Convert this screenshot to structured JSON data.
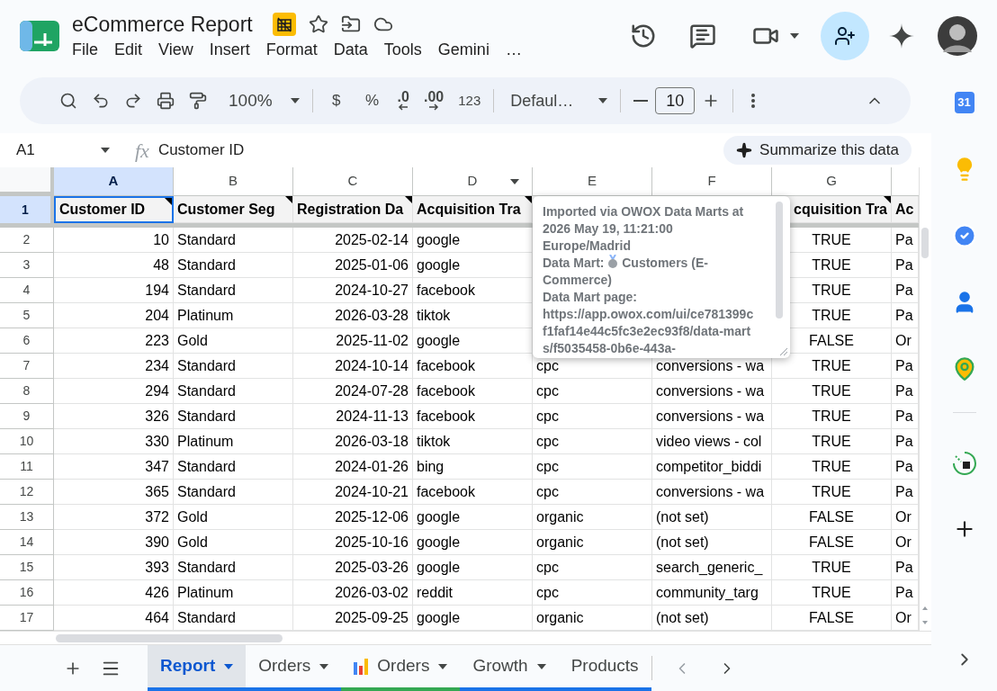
{
  "app": {
    "title": "eCommerce Report",
    "menu": [
      "File",
      "Edit",
      "View",
      "Insert",
      "Format",
      "Data",
      "Tools",
      "Gemini",
      "…"
    ]
  },
  "toolbar": {
    "zoom": "100%",
    "currency": "$",
    "percent": "%",
    "decrease_decimal": ".0",
    "increase_decimal": ".00",
    "number_format": "123",
    "font": "Defaul…",
    "font_size": "10"
  },
  "formula_bar": {
    "cell_ref": "A1",
    "fx": "fx",
    "value": "Customer ID",
    "summarize": "Summarize this data"
  },
  "sheet": {
    "columns": [
      {
        "letter": "A",
        "selected": true,
        "filter": false
      },
      {
        "letter": "B",
        "selected": false,
        "filter": false
      },
      {
        "letter": "C",
        "selected": false,
        "filter": false
      },
      {
        "letter": "D",
        "selected": false,
        "filter": true
      },
      {
        "letter": "E",
        "selected": false,
        "filter": false
      },
      {
        "letter": "F",
        "selected": false,
        "filter": false
      },
      {
        "letter": "G",
        "selected": false,
        "filter": false
      }
    ],
    "header_row": {
      "number": "1",
      "selected": true,
      "cells": [
        {
          "text": "Customer ID",
          "note": true,
          "selected": true
        },
        {
          "text": "Customer Seg",
          "note": true,
          "selected": false
        },
        {
          "text": "Registration Da",
          "note": true,
          "selected": false
        },
        {
          "text": "Acquisition Tra",
          "note": true,
          "selected": false
        },
        null,
        null,
        {
          "text": "cquisition Tra",
          "note": true,
          "selected": false
        },
        {
          "text": "Ac",
          "note": false,
          "selected": false
        }
      ]
    },
    "rows": [
      {
        "number": "2",
        "cells": [
          "10",
          "Standard",
          "2025-02-14",
          "google",
          null,
          null,
          "TRUE",
          "Pa"
        ]
      },
      {
        "number": "3",
        "cells": [
          "48",
          "Standard",
          "2025-01-06",
          "google",
          null,
          null,
          "TRUE",
          "Pa"
        ]
      },
      {
        "number": "4",
        "cells": [
          "194",
          "Standard",
          "2024-10-27",
          "facebook",
          null,
          null,
          "TRUE",
          "Pa"
        ]
      },
      {
        "number": "5",
        "cells": [
          "204",
          "Platinum",
          "2026-03-28",
          "tiktok",
          null,
          null,
          "TRUE",
          "Pa"
        ]
      },
      {
        "number": "6",
        "cells": [
          "223",
          "Gold",
          "2025-11-02",
          "google",
          null,
          null,
          "FALSE",
          "Or"
        ]
      },
      {
        "number": "7",
        "cells": [
          "234",
          "Standard",
          "2024-10-14",
          "facebook",
          "cpc",
          "conversions - wa",
          "TRUE",
          "Pa"
        ]
      },
      {
        "number": "8",
        "cells": [
          "294",
          "Standard",
          "2024-07-28",
          "facebook",
          "cpc",
          "conversions - wa",
          "TRUE",
          "Pa"
        ]
      },
      {
        "number": "9",
        "cells": [
          "326",
          "Standard",
          "2024-11-13",
          "facebook",
          "cpc",
          "conversions - wa",
          "TRUE",
          "Pa"
        ]
      },
      {
        "number": "10",
        "cells": [
          "330",
          "Platinum",
          "2026-03-18",
          "tiktok",
          "cpc",
          "video views - col",
          "TRUE",
          "Pa"
        ]
      },
      {
        "number": "11",
        "cells": [
          "347",
          "Standard",
          "2024-01-26",
          "bing",
          "cpc",
          "competitor_biddi",
          "TRUE",
          "Pa"
        ]
      },
      {
        "number": "12",
        "cells": [
          "365",
          "Standard",
          "2024-10-21",
          "facebook",
          "cpc",
          "conversions - wa",
          "TRUE",
          "Pa"
        ]
      },
      {
        "number": "13",
        "cells": [
          "372",
          "Gold",
          "2025-12-06",
          "google",
          "organic",
          "(not set)",
          "FALSE",
          "Or"
        ]
      },
      {
        "number": "14",
        "cells": [
          "390",
          "Gold",
          "2025-10-16",
          "google",
          "organic",
          "(not set)",
          "FALSE",
          "Or"
        ]
      },
      {
        "number": "15",
        "cells": [
          "393",
          "Standard",
          "2025-03-26",
          "google",
          "cpc",
          "search_generic_",
          "TRUE",
          "Pa"
        ]
      },
      {
        "number": "16",
        "cells": [
          "426",
          "Platinum",
          "2026-03-02",
          "reddit",
          "cpc",
          "community_targ",
          "TRUE",
          "Pa"
        ]
      },
      {
        "number": "17",
        "cells": [
          "464",
          "Standard",
          "2025-09-25",
          "google",
          "organic",
          "(not set)",
          "FALSE",
          "Or"
        ]
      }
    ]
  },
  "comment": {
    "imported": "Imported via OWOX Data Marts at 2026 May 19, 11:21:00 Europe/Madrid",
    "data_mart_label": "Data Mart:",
    "data_mart_name": "Customers (E-Commerce)",
    "page_label": "Data Mart page:",
    "url": "https://app.owox.com/ui/ce781399cf1faf14e44c5fc3e2ec93f8/data-marts/f5035458-0b6e-443a-"
  },
  "sheet_tabs": [
    {
      "label": "Report",
      "selected": true,
      "kind": "sheet",
      "color": "#1a73e8"
    },
    {
      "label": "Orders",
      "selected": false,
      "kind": "sheet",
      "color": "#1a73e8"
    },
    {
      "label": "Orders",
      "selected": false,
      "kind": "chart",
      "color": "#34a853"
    },
    {
      "label": "Growth",
      "selected": false,
      "kind": "sheet",
      "color": "#1a73e8"
    },
    {
      "label": "Products",
      "selected": false,
      "kind": "plain",
      "color": "#1a73e8"
    }
  ],
  "sidebar": {
    "calendar_day": "31"
  }
}
